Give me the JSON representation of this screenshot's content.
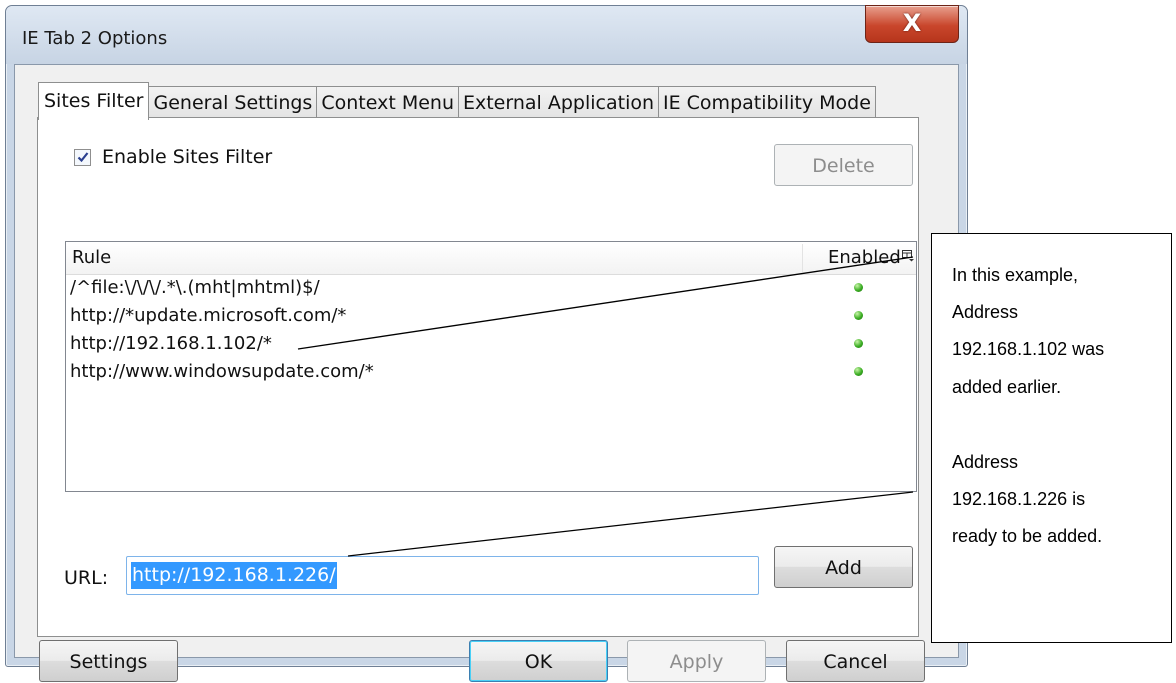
{
  "window": {
    "title": "IE Tab 2 Options",
    "close_glyph": "X"
  },
  "tabs": [
    {
      "label": "Sites Filter",
      "active": true
    },
    {
      "label": "General Settings",
      "active": false
    },
    {
      "label": "Context Menu",
      "active": false
    },
    {
      "label": "External Application",
      "active": false
    },
    {
      "label": "IE Compatibility Mode",
      "active": false
    }
  ],
  "sites_filter": {
    "enable_label": "Enable Sites Filter",
    "enabled": true,
    "delete_label": "Delete",
    "columns": {
      "rule": "Rule",
      "enabled": "Enabled"
    },
    "rules": [
      {
        "rule": "/^file:\\/\\/\\/.*\\.(mht|mhtml)$/",
        "enabled": true
      },
      {
        "rule": "http://*update.microsoft.com/*",
        "enabled": true
      },
      {
        "rule": "http://192.168.1.102/*",
        "enabled": true
      },
      {
        "rule": "http://www.windowsupdate.com/*",
        "enabled": true
      }
    ],
    "url_label": "URL:",
    "url_value": "http://192.168.1.226/",
    "add_label": "Add"
  },
  "footer": {
    "settings_label": "Settings",
    "ok_label": "OK",
    "apply_label": "Apply",
    "cancel_label": "Cancel"
  },
  "callout": {
    "lines": [
      "In this example,",
      "Address",
      "192.168.1.102 was",
      "added earlier.",
      "Address",
      "192.168.1.226 is",
      "ready to be added."
    ]
  },
  "colors": {
    "selection": "#3399ff",
    "enabled_dot": "#3cae24",
    "close_button": "#c9462c"
  }
}
